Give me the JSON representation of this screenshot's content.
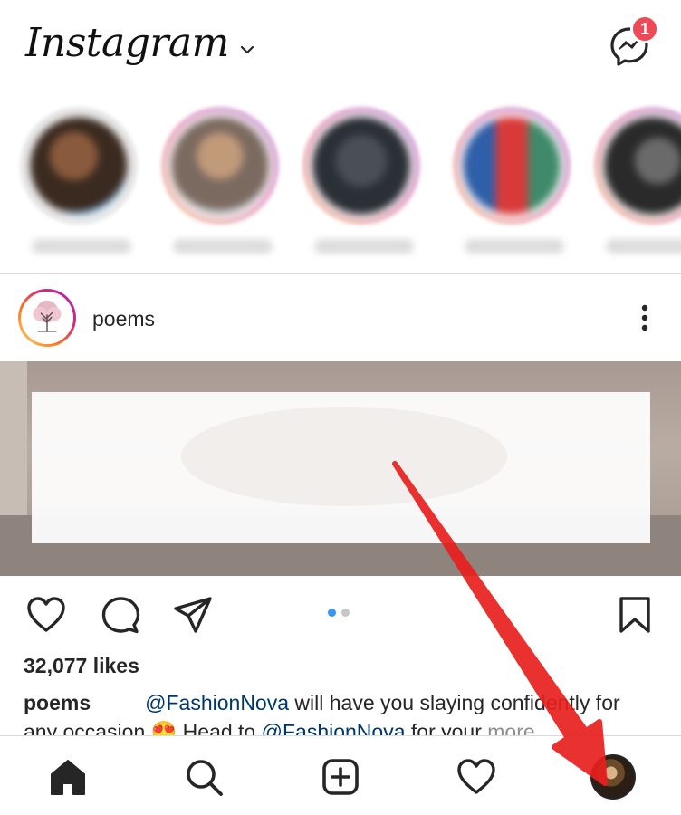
{
  "header": {
    "logo_text": "Instagram",
    "switch_icon": "chevron-down-icon",
    "messenger_icon": "messenger-icon",
    "messenger_badge": "1"
  },
  "stories": {
    "count_visible": 5,
    "blurred": true
  },
  "post": {
    "username": "poems",
    "avatar_icon": "tree-logo-icon",
    "more_icon": "more-vertical-icon",
    "carousel": {
      "pages": 2,
      "current": 1
    },
    "likes": "32,077 likes",
    "caption": {
      "username": "poems",
      "mention_1": "@FashionNova",
      "text_1": " will have you slaying confidently for any occasion ",
      "emoji": "😍",
      "text_2": " Head to ",
      "mention_2": "@FashionNova",
      "text_3": " for your ",
      "more": "more"
    }
  },
  "bottom_nav": {
    "items": [
      "home-icon",
      "search-icon",
      "new-post-icon",
      "activity-icon",
      "profile-avatar"
    ],
    "active": "home-icon"
  },
  "colors": {
    "badge": "#ed4956",
    "link": "#00376b",
    "dot_active": "#3897f0",
    "arrow": "#e8201e"
  }
}
